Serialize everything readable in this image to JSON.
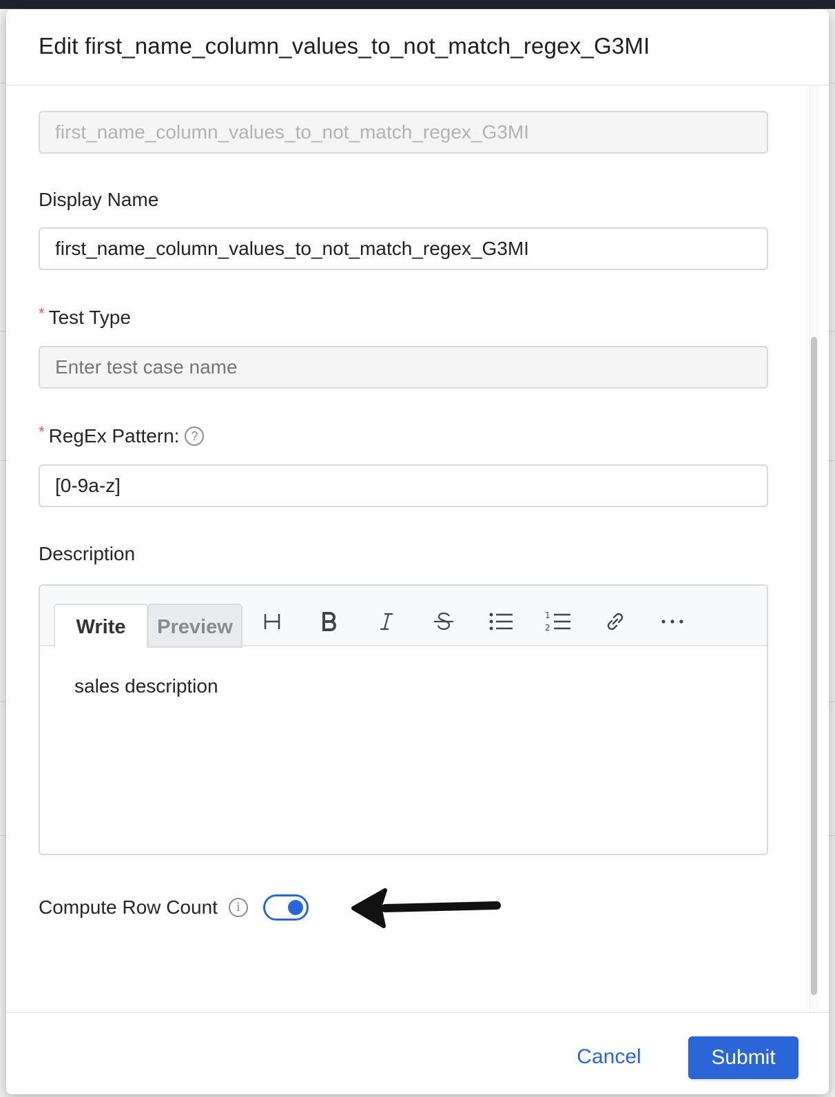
{
  "modal": {
    "title": "Edit first_name_column_values_to_not_match_regex_G3MI"
  },
  "form": {
    "name_value": "first_name_column_values_to_not_match_regex_G3MI",
    "display_name_label": "Display Name",
    "display_name_value": "first_name_column_values_to_not_match_regex_G3MI",
    "test_type_label": "Test Type",
    "test_type_placeholder": "Enter test case name",
    "regex_label": "RegEx Pattern:",
    "regex_value": "[0-9a-z]",
    "description_label": "Description",
    "description_text": "sales description",
    "compute_row_count_label": "Compute Row Count",
    "compute_row_count_enabled": true
  },
  "editor": {
    "tab_write": "Write",
    "tab_preview": "Preview",
    "tools": [
      "heading-icon",
      "bold-icon",
      "italic-icon",
      "strikethrough-icon",
      "bullet-list-icon",
      "numbered-list-icon",
      "link-icon",
      "more-icon"
    ]
  },
  "footer": {
    "cancel_label": "Cancel",
    "submit_label": "Submit"
  },
  "colors": {
    "primary": "#2b66d9",
    "required": "#ff4d4f"
  }
}
